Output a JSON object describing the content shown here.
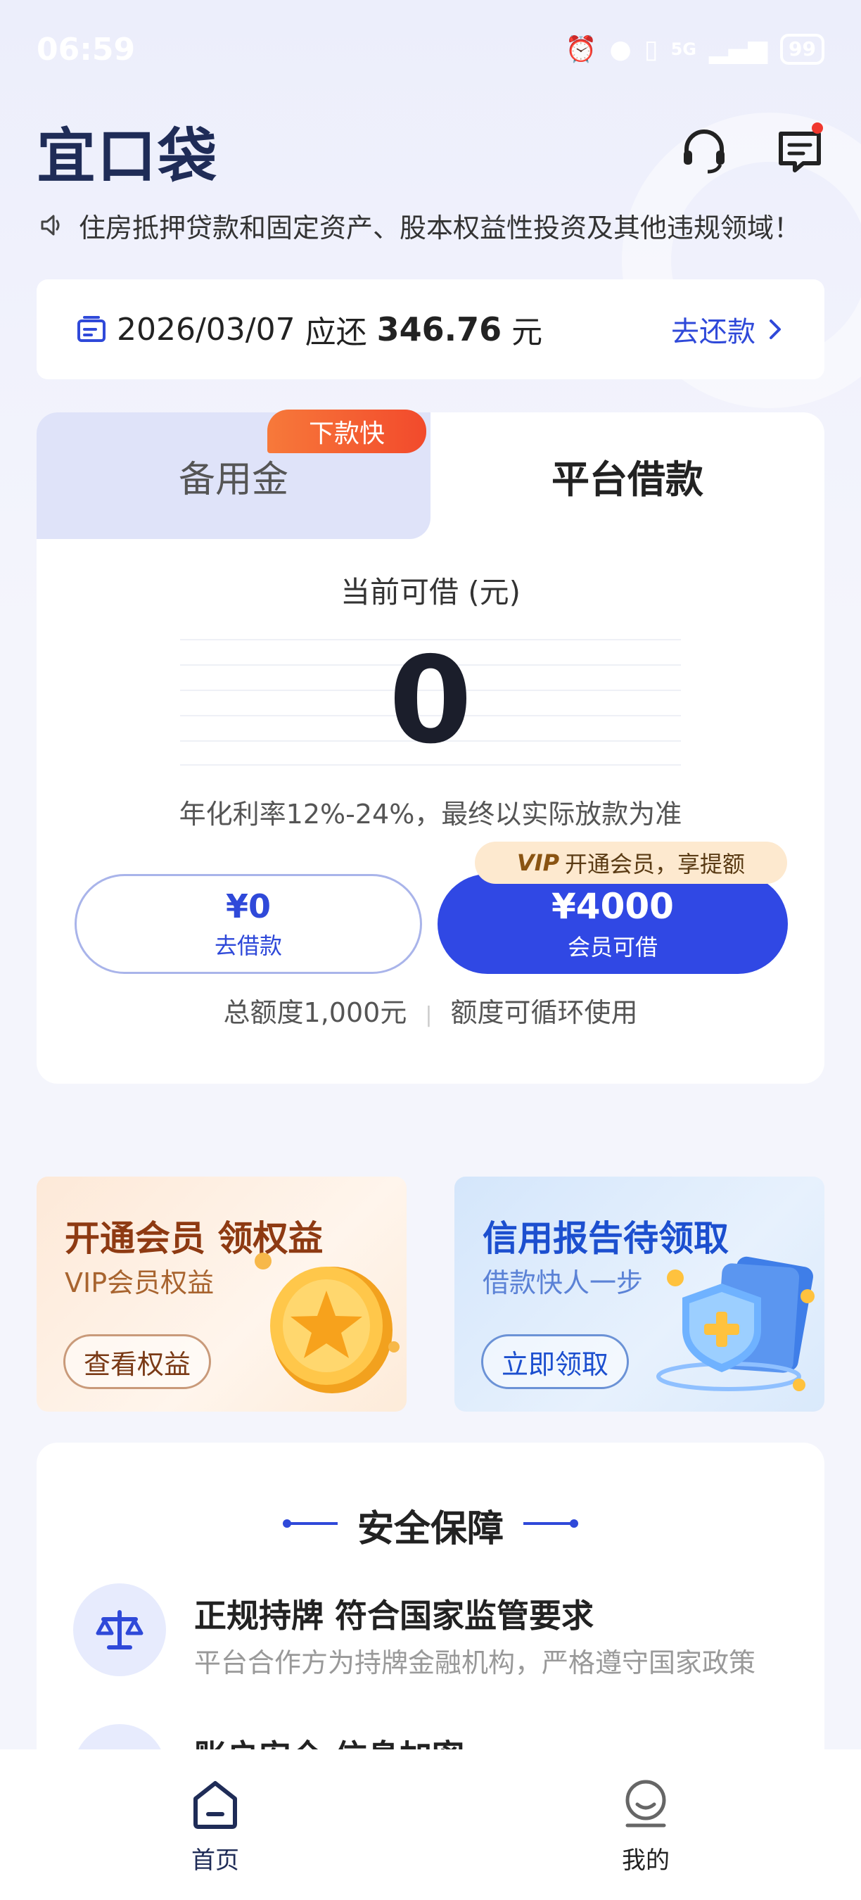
{
  "status_bar": {
    "time": "06:59",
    "network": "5G",
    "battery": "99"
  },
  "header": {
    "logo": "宜口袋",
    "support_icon": "headset-icon",
    "message_icon": "message-icon"
  },
  "notice": {
    "icon": "speaker-icon",
    "text": "住房抵押贷款和固定资产、股本权益性投资及其他违规领域！"
  },
  "repayment": {
    "date": "2026/03/07",
    "due_label": "应还",
    "amount": "346.76",
    "unit": "元",
    "action": "去还款"
  },
  "loan_tabs": {
    "reserve": "备用金",
    "reserve_badge": "下款快",
    "platform": "平台借款"
  },
  "loan": {
    "available_label": "当前可借 (元)",
    "available_value": "0",
    "rate_text": "年化利率12%-24%，最终以实际放款为准",
    "borrow_amount": "¥0",
    "borrow_label": "去借款",
    "member_amount": "¥4000",
    "member_label": "会员可借",
    "vip_tag_prefix": "VIP",
    "vip_tag_text": "开通会员，享提额",
    "total_quota": "总额度1,000元",
    "cycle_text": "额度可循环使用"
  },
  "promos": {
    "vip": {
      "title": "开通会员 领权益",
      "subtitle": "VIP会员权益",
      "button": "查看权益"
    },
    "credit": {
      "title": "信用报告待领取",
      "subtitle": "借款快人一步",
      "button": "立即领取"
    }
  },
  "safety": {
    "title": "安全保障",
    "items": [
      {
        "title": "正规持牌 符合国家监管要求",
        "subtitle": "平台合作方为持牌金融机构，严格遵守国家政策",
        "icon": "scale-icon"
      },
      {
        "title": "账户安全 信息加密",
        "subtitle": "",
        "icon": "shield-icon"
      }
    ]
  },
  "tabbar": {
    "home": "首页",
    "mine": "我的"
  },
  "colors": {
    "primary": "#3048e4",
    "link": "#2f49d9",
    "badge": "#f24a2c",
    "logo": "#1f2c57"
  }
}
